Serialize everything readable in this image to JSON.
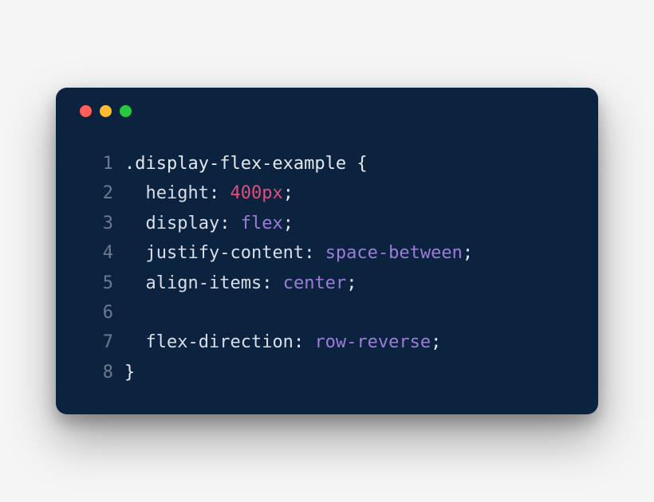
{
  "colors": {
    "window_bg": "#0c2340",
    "red": "#ff5f57",
    "yellow": "#febc2e",
    "green": "#28c840",
    "line_number": "#6b7a8f",
    "text": "#e3e8ef",
    "number_literal": "#e04f7a",
    "value_keyword": "#9d7cd8"
  },
  "code": {
    "lines": [
      {
        "n": "1",
        "tokens": [
          {
            "t": ".display-flex-example ",
            "c": "selector"
          },
          {
            "t": "{",
            "c": "punct"
          }
        ]
      },
      {
        "n": "2",
        "tokens": [
          {
            "t": "  ",
            "c": "default"
          },
          {
            "t": "height",
            "c": "prop"
          },
          {
            "t": ": ",
            "c": "punct"
          },
          {
            "t": "400px",
            "c": "number"
          },
          {
            "t": ";",
            "c": "punct"
          }
        ]
      },
      {
        "n": "3",
        "tokens": [
          {
            "t": "  ",
            "c": "default"
          },
          {
            "t": "display",
            "c": "prop"
          },
          {
            "t": ": ",
            "c": "punct"
          },
          {
            "t": "flex",
            "c": "value"
          },
          {
            "t": ";",
            "c": "punct"
          }
        ]
      },
      {
        "n": "4",
        "tokens": [
          {
            "t": "  ",
            "c": "default"
          },
          {
            "t": "justify-content",
            "c": "prop"
          },
          {
            "t": ": ",
            "c": "punct"
          },
          {
            "t": "space-between",
            "c": "value"
          },
          {
            "t": ";",
            "c": "punct"
          }
        ]
      },
      {
        "n": "5",
        "tokens": [
          {
            "t": "  ",
            "c": "default"
          },
          {
            "t": "align-items",
            "c": "prop"
          },
          {
            "t": ": ",
            "c": "punct"
          },
          {
            "t": "center",
            "c": "value"
          },
          {
            "t": ";",
            "c": "punct"
          }
        ]
      },
      {
        "n": "6",
        "tokens": []
      },
      {
        "n": "7",
        "tokens": [
          {
            "t": "  ",
            "c": "default"
          },
          {
            "t": "flex-direction",
            "c": "prop"
          },
          {
            "t": ": ",
            "c": "punct"
          },
          {
            "t": "row-reverse",
            "c": "value"
          },
          {
            "t": ";",
            "c": "punct"
          }
        ]
      },
      {
        "n": "8",
        "tokens": [
          {
            "t": "}",
            "c": "punct"
          }
        ]
      }
    ]
  }
}
